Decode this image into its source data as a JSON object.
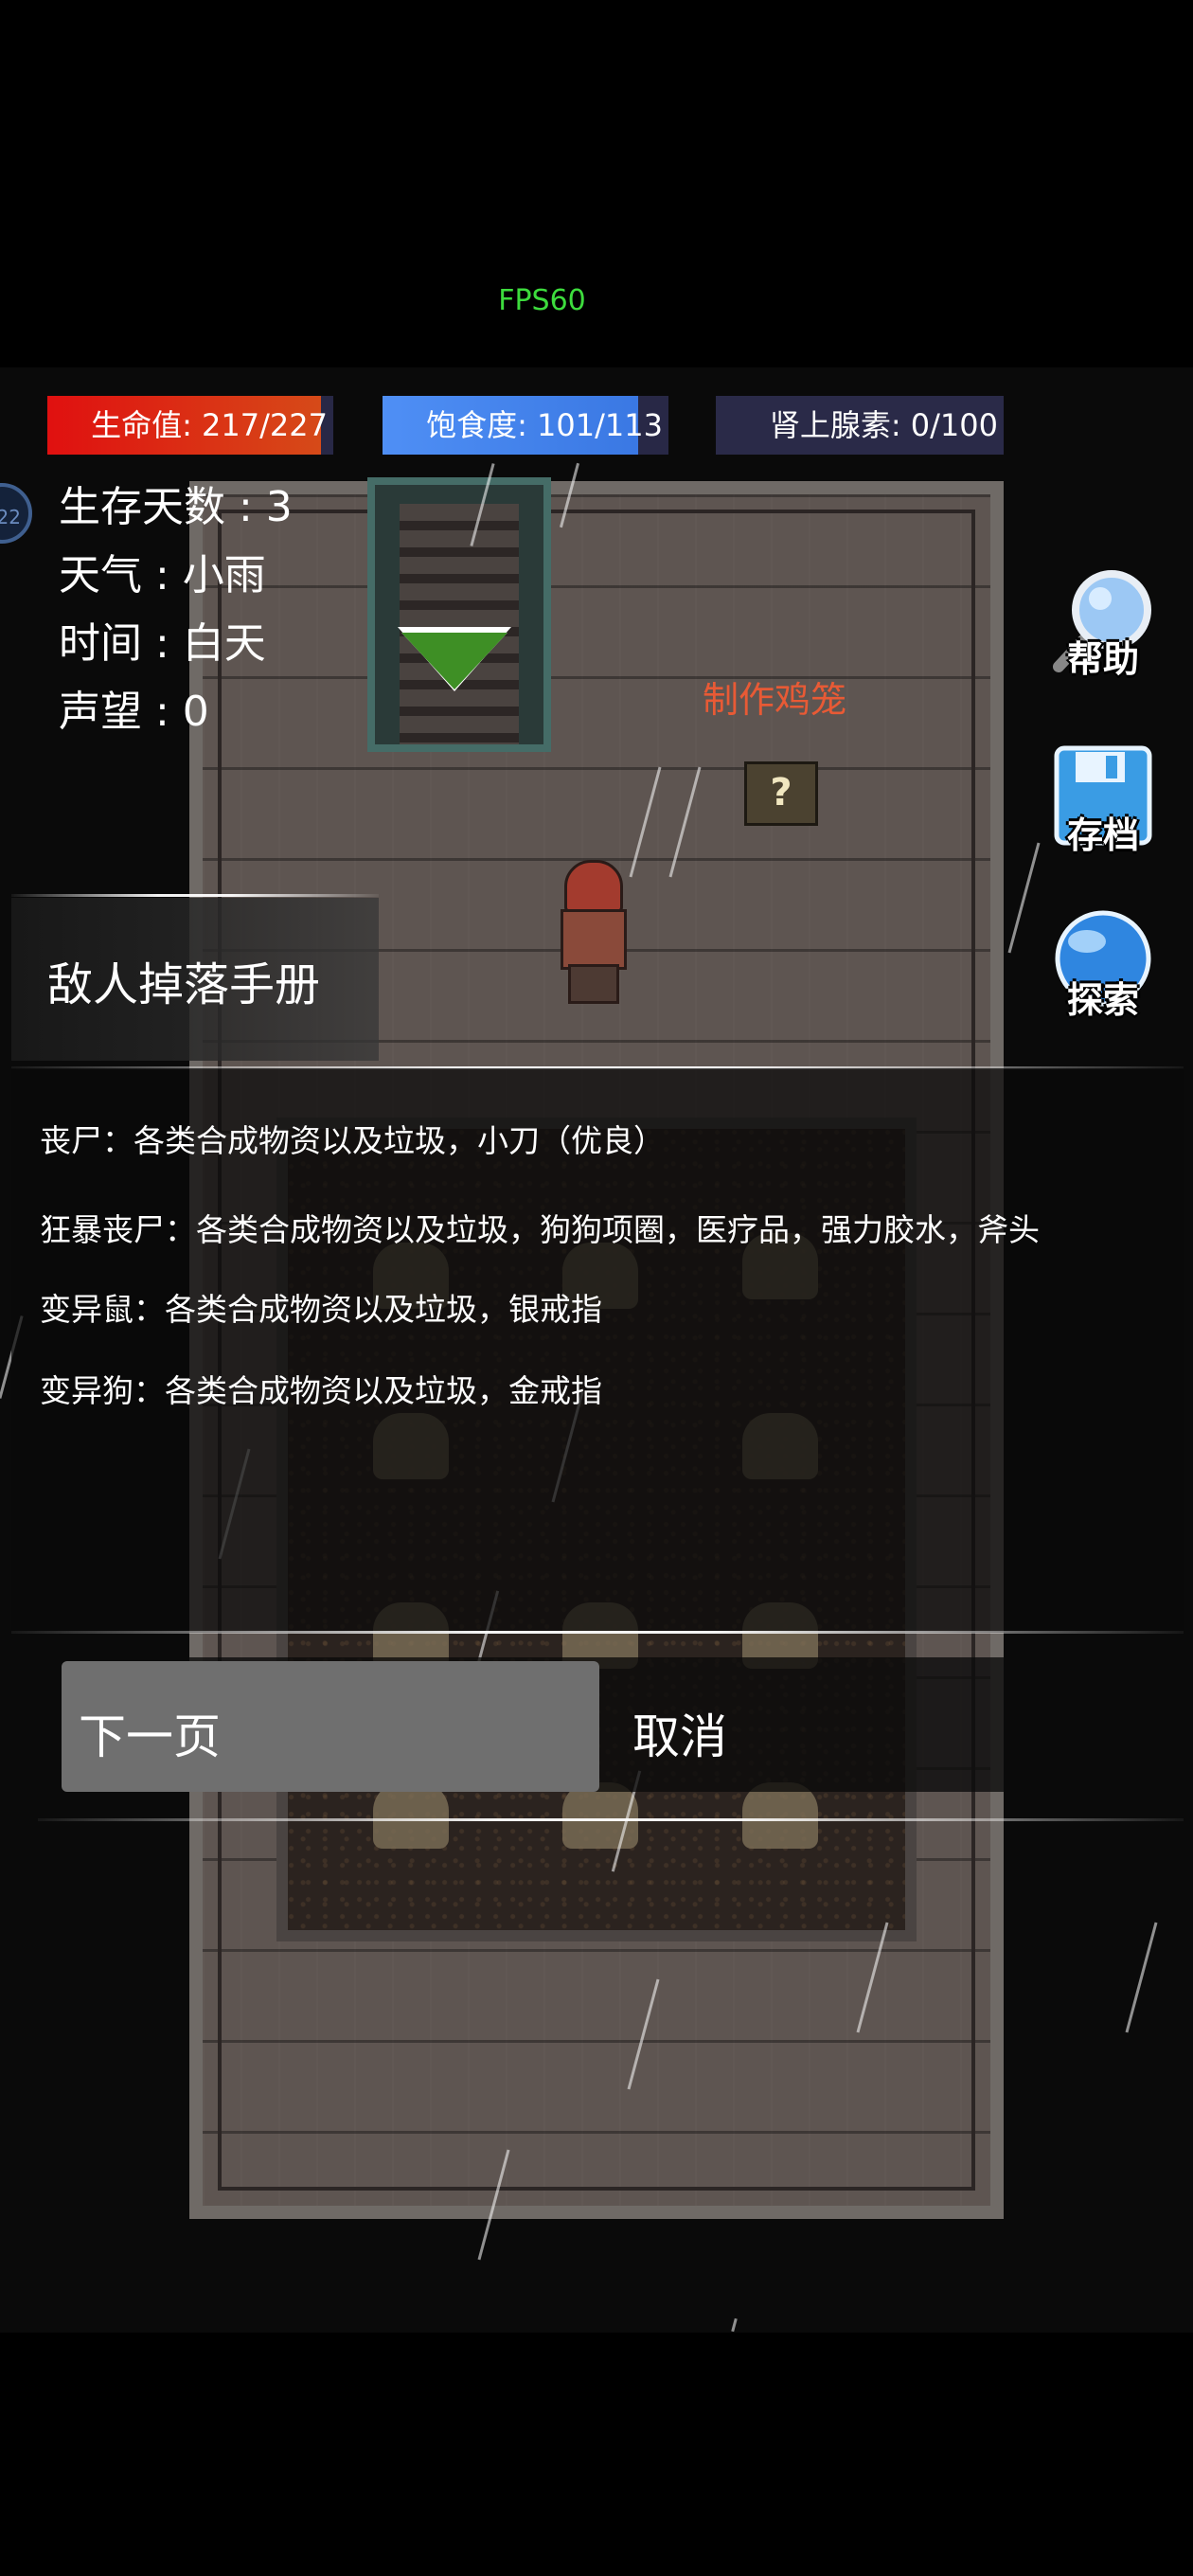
{
  "fps": "FPS60",
  "hud": {
    "hp": {
      "label": "生命值: 217/227",
      "current": 217,
      "max": 227,
      "color": "#e01010"
    },
    "food": {
      "label": "饱食度: 101/113",
      "current": 101,
      "max": 113,
      "color": "#4f8ff5"
    },
    "adrenaline": {
      "label": "肾上腺素: 0/100",
      "current": 0,
      "max": 100
    }
  },
  "level_badge": "22",
  "stats": {
    "days": "生存天数 : 3",
    "weather": "天气 : 小雨",
    "time": "时间 : 白天",
    "reputation": "声望 : 0"
  },
  "world": {
    "craft_label": "制作鸡笼",
    "mystery_box": "?"
  },
  "side_buttons": {
    "help": "帮助",
    "save": "存档",
    "explore": "探索"
  },
  "icons": {
    "help": "magnifier-icon",
    "save": "floppy-disk-icon",
    "explore": "globe-icon"
  },
  "dialog": {
    "title": "敌人掉落手册",
    "drops": [
      "丧尸：各类合成物资以及垃圾，小刀（优良）",
      "狂暴丧尸：各类合成物资以及垃圾，狗狗项圈，医疗品，强力胶水，斧头",
      "变异鼠：各类合成物资以及垃圾，银戒指",
      "变异狗：各类合成物资以及垃圾，金戒指"
    ],
    "next_label": "下一页",
    "cancel_label": "取消"
  },
  "colors": {
    "fps_green": "#3ddc3d",
    "craft_label": "#e85a35",
    "next_button_bg": "#6f6f6f"
  }
}
